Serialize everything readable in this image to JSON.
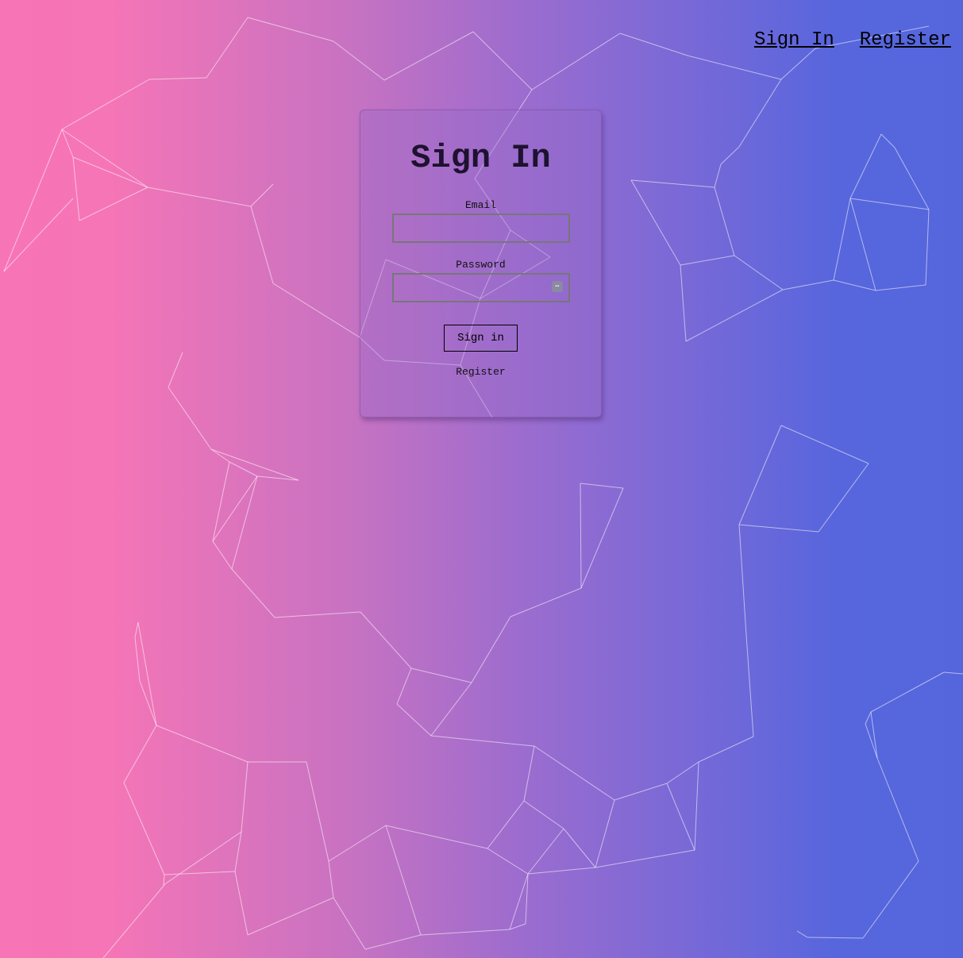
{
  "nav": {
    "sign_in": "Sign In",
    "register": "Register"
  },
  "form": {
    "title": "Sign In",
    "email_label": "Email",
    "email_value": "",
    "password_label": "Password",
    "password_value": "",
    "submit_label": "Sign in",
    "register_label": "Register"
  },
  "colors": {
    "gradient_left": "#f774b6",
    "gradient_right": "#5566dd",
    "network_lines": "#ffffff"
  }
}
